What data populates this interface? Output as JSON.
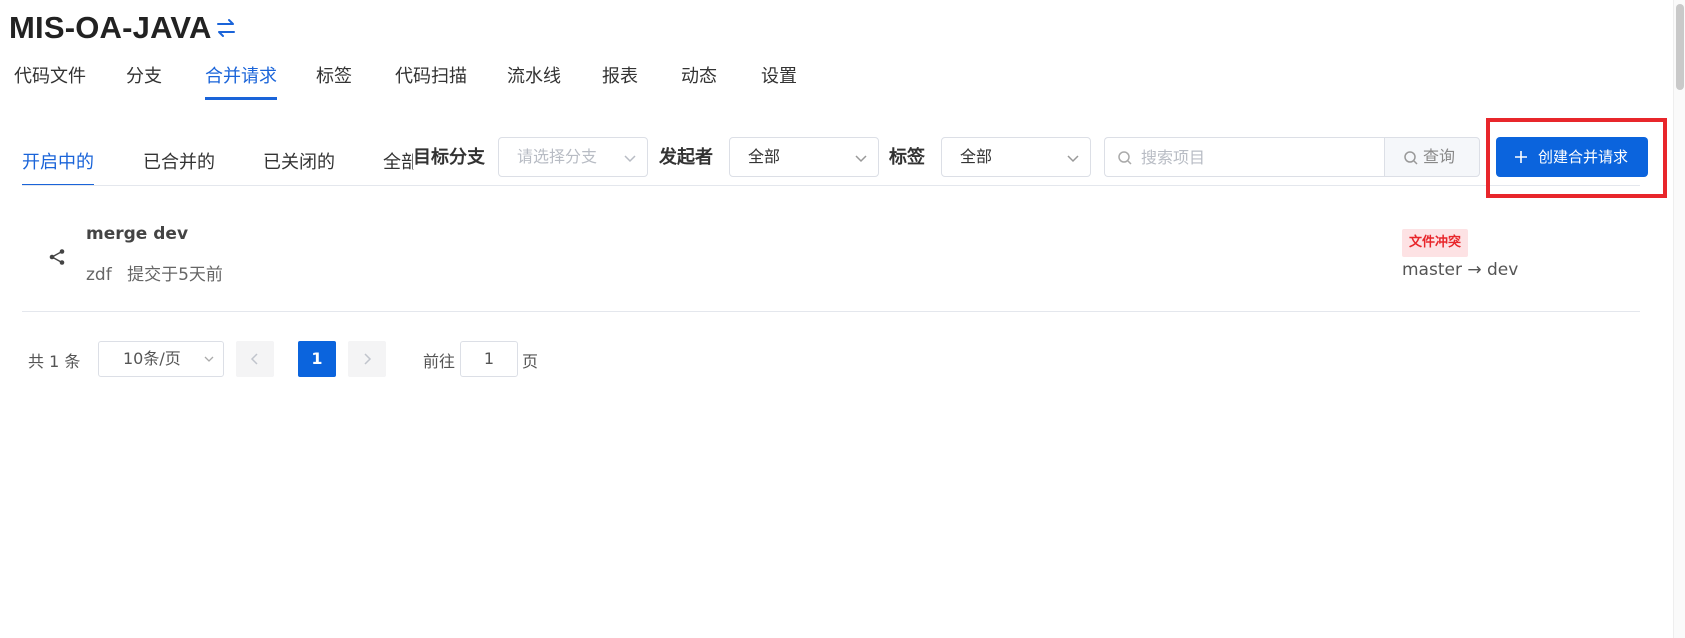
{
  "project": {
    "title": "MIS-OA-JAVA",
    "switch_icon": "switch-arrows-icon"
  },
  "top_nav": {
    "items": [
      {
        "label": "代码文件"
      },
      {
        "label": "分支"
      },
      {
        "label": "合并请求"
      },
      {
        "label": "标签"
      },
      {
        "label": "代码扫描"
      },
      {
        "label": "流水线"
      },
      {
        "label": "报表"
      },
      {
        "label": "动态"
      },
      {
        "label": "设置"
      }
    ],
    "active": "合并请求"
  },
  "state_tabs": {
    "items": [
      {
        "label": "开启中的"
      },
      {
        "label": "已合并的"
      },
      {
        "label": "已关闭的"
      },
      {
        "label": "全部"
      }
    ],
    "active": "开启中的"
  },
  "filters": {
    "target_branch": {
      "label": "目标分支",
      "placeholder": "请选择分支"
    },
    "initiator": {
      "label": "发起者",
      "value": "全部"
    },
    "tag": {
      "label": "标签",
      "value": "全部"
    },
    "search": {
      "placeholder": "搜索项目",
      "button": "查询"
    }
  },
  "create_button": {
    "label": "创建合并请求"
  },
  "merge_requests": [
    {
      "title": "merge dev",
      "author": "zdf",
      "time": "提交于5天前",
      "badge": "文件冲突",
      "source_branch": "master",
      "arrow": "→",
      "target_branch": "dev"
    }
  ],
  "pagination": {
    "total": "共 1 条",
    "page_size": "10条/页",
    "current": "1",
    "goto_label": "前往",
    "goto_value": "1",
    "page_label": "页"
  },
  "colors": {
    "accent": "#0b64dd",
    "danger": "#e8262b",
    "badge_bg": "#fde2e4"
  }
}
